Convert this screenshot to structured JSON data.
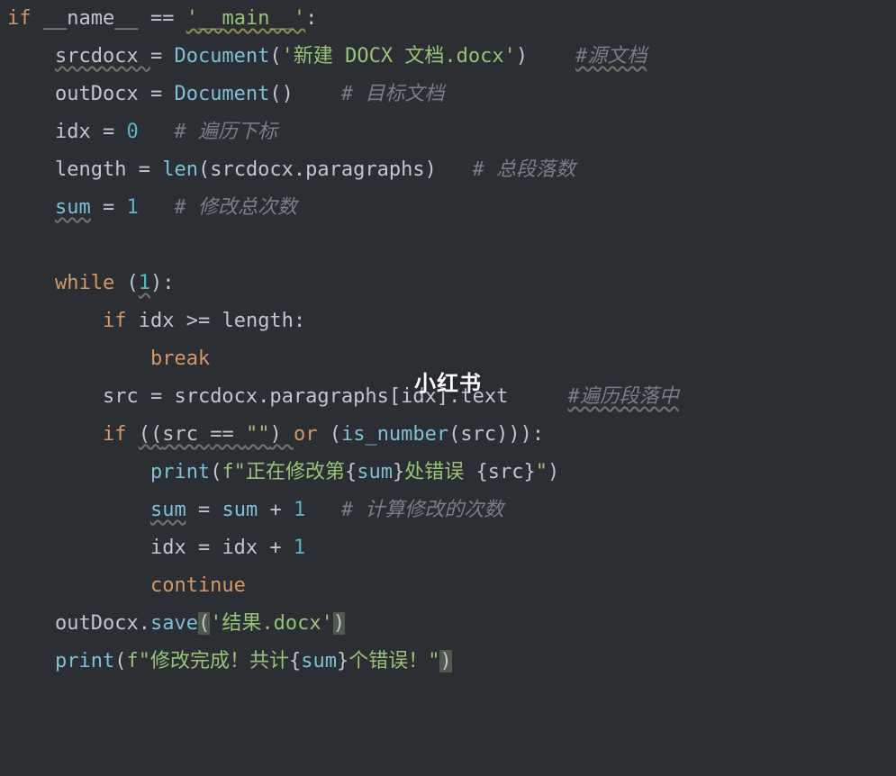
{
  "watermark": "小红书",
  "code": {
    "lines": [
      {
        "indent": 0,
        "tokens": [
          {
            "t": "if ",
            "c": "kw"
          },
          {
            "t": "__name__ ",
            "c": "id"
          },
          {
            "t": "== ",
            "c": "punc"
          },
          {
            "t": "'__main__'",
            "c": "str",
            "wavy": "y"
          },
          {
            "t": ":",
            "c": "punc"
          }
        ]
      },
      {
        "indent": 1,
        "tokens": [
          {
            "t": "srcdocx ",
            "c": "id",
            "wavy": "g"
          },
          {
            "t": "= ",
            "c": "punc"
          },
          {
            "t": "Document",
            "c": "fn"
          },
          {
            "t": "(",
            "c": "punc"
          },
          {
            "t": "'新建 DOCX 文档.docx'",
            "c": "str"
          },
          {
            "t": ")",
            "c": "punc"
          },
          {
            "t": "    ",
            "c": "id"
          },
          {
            "t": "#源文档",
            "c": "cmt",
            "wavy": "g"
          }
        ]
      },
      {
        "indent": 1,
        "tokens": [
          {
            "t": "outDocx ",
            "c": "id"
          },
          {
            "t": "= ",
            "c": "punc"
          },
          {
            "t": "Document",
            "c": "fn"
          },
          {
            "t": "()",
            "c": "punc"
          },
          {
            "t": "    ",
            "c": "id"
          },
          {
            "t": "# 目标文档",
            "c": "cmt"
          }
        ]
      },
      {
        "indent": 1,
        "tokens": [
          {
            "t": "idx ",
            "c": "id"
          },
          {
            "t": "= ",
            "c": "punc"
          },
          {
            "t": "0",
            "c": "num"
          },
          {
            "t": "   ",
            "c": "id"
          },
          {
            "t": "# 遍历下标",
            "c": "cmt"
          }
        ]
      },
      {
        "indent": 1,
        "tokens": [
          {
            "t": "length ",
            "c": "id"
          },
          {
            "t": "= ",
            "c": "punc"
          },
          {
            "t": "len",
            "c": "fn"
          },
          {
            "t": "(",
            "c": "punc"
          },
          {
            "t": "srcdocx",
            "c": "id"
          },
          {
            "t": ".",
            "c": "punc"
          },
          {
            "t": "paragraphs",
            "c": "id"
          },
          {
            "t": ")",
            "c": "punc"
          },
          {
            "t": "   ",
            "c": "id"
          },
          {
            "t": "# 总段落数",
            "c": "cmt"
          }
        ]
      },
      {
        "indent": 1,
        "tokens": [
          {
            "t": "sum",
            "c": "fn",
            "wavy": "g"
          },
          {
            "t": " ",
            "c": "id"
          },
          {
            "t": "= ",
            "c": "punc"
          },
          {
            "t": "1",
            "c": "num"
          },
          {
            "t": "   ",
            "c": "id"
          },
          {
            "t": "# 修改总次数",
            "c": "cmt"
          }
        ]
      },
      {
        "indent": 1,
        "tokens": []
      },
      {
        "indent": 1,
        "tokens": [
          {
            "t": "while ",
            "c": "kw"
          },
          {
            "t": "(",
            "c": "punc"
          },
          {
            "t": "1",
            "c": "num",
            "wavy": "g"
          },
          {
            "t": ")",
            "c": "punc"
          },
          {
            "t": ":",
            "c": "punc"
          }
        ]
      },
      {
        "indent": 2,
        "tokens": [
          {
            "t": "if ",
            "c": "kw"
          },
          {
            "t": "idx ",
            "c": "id"
          },
          {
            "t": ">= ",
            "c": "punc"
          },
          {
            "t": "length",
            "c": "id"
          },
          {
            "t": ":",
            "c": "punc"
          }
        ]
      },
      {
        "indent": 3,
        "tokens": [
          {
            "t": "break",
            "c": "kw"
          }
        ]
      },
      {
        "indent": 2,
        "tokens": [
          {
            "t": "src ",
            "c": "id"
          },
          {
            "t": "= ",
            "c": "punc"
          },
          {
            "t": "srcdocx",
            "c": "id"
          },
          {
            "t": ".",
            "c": "punc"
          },
          {
            "t": "paragraphs",
            "c": "id"
          },
          {
            "t": "[",
            "c": "punc"
          },
          {
            "t": "idx",
            "c": "id"
          },
          {
            "t": "]",
            "c": "punc"
          },
          {
            "t": ".",
            "c": "punc"
          },
          {
            "t": "text",
            "c": "id"
          },
          {
            "t": "     ",
            "c": "id"
          },
          {
            "t": "#遍历段落中",
            "c": "cmt",
            "wavy": "g"
          }
        ]
      },
      {
        "indent": 2,
        "tokens": [
          {
            "t": "if ",
            "c": "kw"
          },
          {
            "t": "((",
            "c": "punc",
            "wavy": "g"
          },
          {
            "t": "src ",
            "c": "id",
            "wavy": "g"
          },
          {
            "t": "== ",
            "c": "punc",
            "wavy": "g"
          },
          {
            "t": "\"\"",
            "c": "str",
            "wavy": "g"
          },
          {
            "t": ") ",
            "c": "punc",
            "wavy": "g"
          },
          {
            "t": "or ",
            "c": "kw"
          },
          {
            "t": "(",
            "c": "punc"
          },
          {
            "t": "is_number",
            "c": "fn"
          },
          {
            "t": "(",
            "c": "punc"
          },
          {
            "t": "src",
            "c": "id"
          },
          {
            "t": ")))",
            "c": "punc"
          },
          {
            "t": ":",
            "c": "punc"
          }
        ]
      },
      {
        "indent": 3,
        "tokens": [
          {
            "t": "print",
            "c": "fn"
          },
          {
            "t": "(",
            "c": "punc"
          },
          {
            "t": "f\"",
            "c": "str"
          },
          {
            "t": "正在修改第",
            "c": "str"
          },
          {
            "t": "{",
            "c": "punc"
          },
          {
            "t": "sum",
            "c": "fn"
          },
          {
            "t": "}",
            "c": "punc"
          },
          {
            "t": "处错误 ",
            "c": "str"
          },
          {
            "t": "{",
            "c": "punc"
          },
          {
            "t": "src",
            "c": "id"
          },
          {
            "t": "}",
            "c": "punc"
          },
          {
            "t": "\"",
            "c": "str"
          },
          {
            "t": ")",
            "c": "punc"
          }
        ]
      },
      {
        "indent": 3,
        "tokens": [
          {
            "t": "sum",
            "c": "fn",
            "wavy": "g"
          },
          {
            "t": " ",
            "c": "id"
          },
          {
            "t": "= ",
            "c": "punc"
          },
          {
            "t": "sum ",
            "c": "fn"
          },
          {
            "t": "+ ",
            "c": "punc"
          },
          {
            "t": "1",
            "c": "num"
          },
          {
            "t": "   ",
            "c": "id"
          },
          {
            "t": "# 计算修改的次数",
            "c": "cmt"
          }
        ]
      },
      {
        "indent": 3,
        "tokens": [
          {
            "t": "idx ",
            "c": "id"
          },
          {
            "t": "= ",
            "c": "punc"
          },
          {
            "t": "idx ",
            "c": "id"
          },
          {
            "t": "+ ",
            "c": "punc"
          },
          {
            "t": "1",
            "c": "num"
          }
        ]
      },
      {
        "indent": 3,
        "tokens": [
          {
            "t": "continue",
            "c": "kw"
          }
        ]
      },
      {
        "indent": 1,
        "tokens": [
          {
            "t": "outDocx",
            "c": "id"
          },
          {
            "t": ".",
            "c": "punc"
          },
          {
            "t": "save",
            "c": "fn"
          },
          {
            "t": "(",
            "c": "punc",
            "hl": true
          },
          {
            "t": "'结果.docx'",
            "c": "str"
          },
          {
            "t": ")",
            "c": "punc",
            "hl": true
          }
        ]
      },
      {
        "indent": 1,
        "tokens": [
          {
            "t": "print",
            "c": "fn"
          },
          {
            "t": "(",
            "c": "punc"
          },
          {
            "t": "f\"",
            "c": "str"
          },
          {
            "t": "修改完成！共计",
            "c": "str"
          },
          {
            "t": "{",
            "c": "punc"
          },
          {
            "t": "sum",
            "c": "fn"
          },
          {
            "t": "}",
            "c": "punc"
          },
          {
            "t": "个错误！\"",
            "c": "str"
          },
          {
            "t": ")",
            "c": "punc",
            "hl": true
          }
        ]
      }
    ]
  }
}
